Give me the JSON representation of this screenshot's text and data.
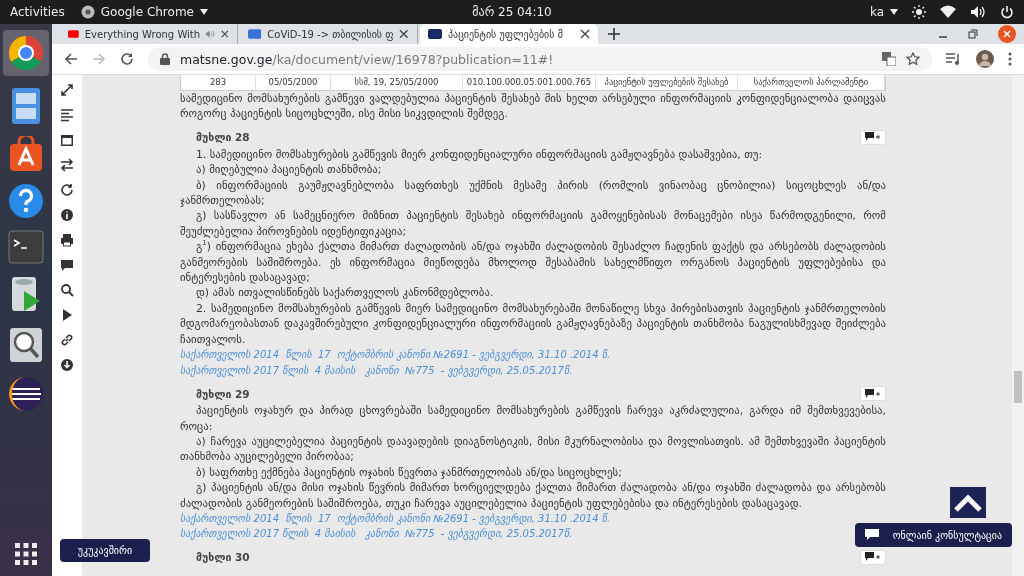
{
  "system_bar": {
    "activities": "Activities",
    "app_menu": "Google Chrome",
    "clock": "მარ 25  04:10",
    "language": "ka"
  },
  "browser": {
    "tabs": [
      {
        "title": "Everything Wrong With",
        "kind": "video",
        "audio": true,
        "selected": false
      },
      {
        "title": "CoViD-19 -> თბილისის ფ",
        "kind": "doc",
        "audio": false,
        "selected": false
      },
      {
        "title": "პაციენტის უფლებების შ",
        "kind": "site",
        "audio": false,
        "selected": true
      }
    ],
    "url_host": "matsne.gov.ge",
    "url_path": "/ka/document/view/16978?publication=11#!"
  },
  "table_row": [
    "283",
    "05/05/2000",
    "სსმ, 19, 25/05/2000",
    "010.100.000.05.001.000.765",
    "პაციენტის უფლებების შესახებ",
    "საქართველოს პარლამენტი"
  ],
  "intro_paragraph": "სამედიცინო მომსახურების გამწევი ვალდებულია პაციენტის შესახებ მის ხელთ არსებული ინფორმაციის კონფიდენციალობა დაიცვას როგორც პაციენტის სიცოცხლეში, ისე მისი სიკვდილის შემდეგ.",
  "articles": [
    {
      "heading": "მუხლი 28",
      "paragraphs": [
        "1. სამედიცინო მომსახურების გამწევის მიერ კონფიდენციალური ინფორმაციის გამჟღავნება დასაშვებია, თუ:",
        "ა) მიღებულია პაციენტის თანხმობა;",
        "ბ) ინფორმაციის გაუმჟღავნებლობა საფრთხეს უქმნის მესამე პირის (რომლის ვინაობაც ცნობილია) სიცოცხლეს ან/და ჯანმრთელობას;",
        "გ) სასწავლო ან სამეცნიერო მიზნით პაციენტის შესახებ ინფორმაციის გამოყენებისას მონაცემები ისეა წარმოდგენილი, რომ შეუძლებელია პიროვნების იდენტიფიკაცია;",
        "გ$^{1}$) ინფორმაცია ეხება ქალთა მიმართ ძალადობის ან/და ოჯახში ძალადობის შესაძლო ჩადენის ფაქტს და არსებობს ძალადობის განმეორების საშიშროება. ეს ინფორმაცია მიეწოდება მხოლოდ შესაბამის სახელმწიფო ორგანოს პაციენტის უფლებებისა და ინტერესების დასაცავად;",
        "დ) ამას ითვალისწინებს საქართველოს კანონმდებლობა.",
        "2. სამედიცინო მომსახურების გამწევის მიერ სამედიცინო მომსახურებაში მონაწილე სხვა პირებისათვის პაციენტის ჯანმრთელობის მდგომარეობასთან დაკავშირებული კონფიდენციალური ინფორმაციის გამჟღავნებაზე პაციენტის თანხმობა ნაგულისხმევად შეიძლება ჩაითვალოს."
      ],
      "amendments": [
        "საქართველოს 2014  წლის  17  ოქტომბრის კანონი №2691 - ვებგვერდი, 31.10 .2014 წ.",
        "საქართველოს 2017 წლის  4 მაისის   კანონი  №775  - ვებგვერდი, 25.05.2017წ."
      ]
    },
    {
      "heading": "მუხლი 29",
      "paragraphs": [
        "პაციენტის ოჯახურ და პირად ცხოვრებაში სამედიცინო მომსახურების გამწევის ჩარევა აკრძალულია, გარდა იმ შემთხვევებისა, როცა:",
        "ა) ჩარევა აუცილებელია პაციენტის დაავადების დიაგნოსტიკის, მისი მკურნალობისა და მოვლისათვის. ამ შემთხვევაში პაციენტის თანხმობა აუცილებელი პირობაა;",
        "ბ) საფრთხე ექმნება პაციენტის ოჯახის წევრთა ჯანმრთელობას ან/და სიცოცხლეს;",
        "გ) პაციენტის ან/და მისი ოჯახის წევრის მიმართ ხორციელდება ქალთა მიმართ ძალადობა ან/და ოჯახში ძალადობა და არსებობს ძალადობის განმეორების საშიშროება, თუკი ჩარევა აუცილებელია პაციენტის უფლებებისა და ინტერესების დასაცავად."
      ],
      "amendments": [
        "საქართველოს 2014  წლის  17  ოქტომბრის კანონი №2691 - ვებგვერდი, 31.10 .2014 წ.",
        "საქართველოს 2017 წლის  4 მაისის   კანონი  №775  - ვებგვერდი, 25.05.2017წ."
      ]
    },
    {
      "heading": "მუხლი 30"
    }
  ],
  "feedback_button": "უკუკავშირი",
  "consult_button": "ონლაინ კონსულტაცია"
}
